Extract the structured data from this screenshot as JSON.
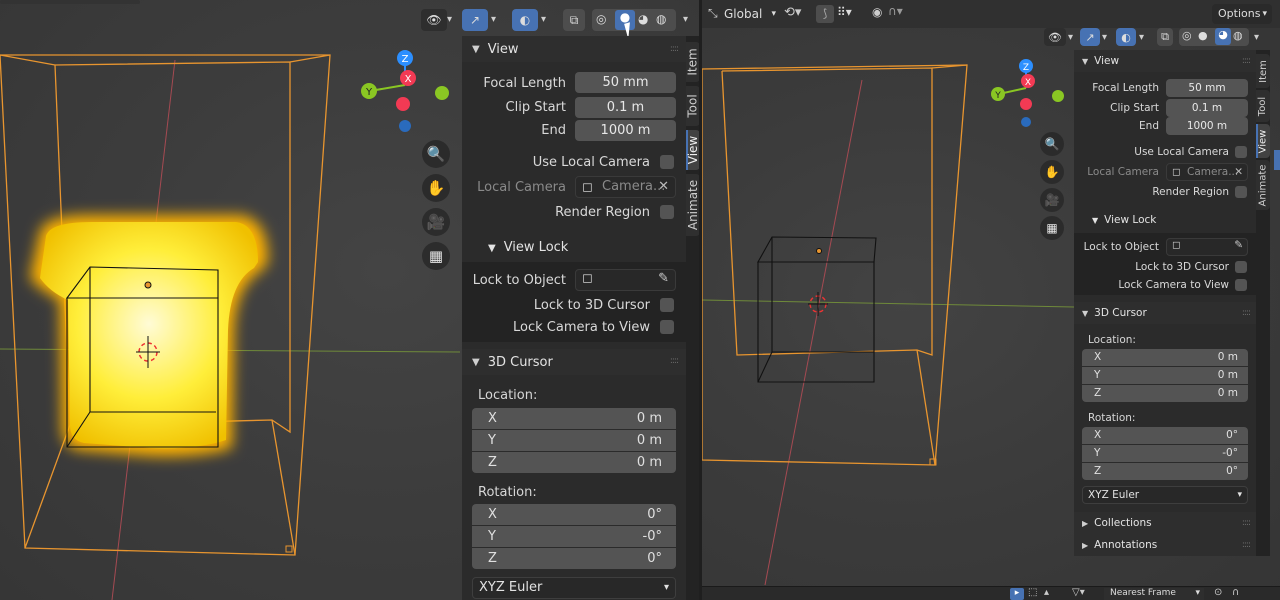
{
  "left": {
    "panel": {
      "view_title": "View",
      "focal_length_label": "Focal Length",
      "focal_length_value": "50 mm",
      "clip_start_label": "Clip Start",
      "clip_start_value": "0.1 m",
      "end_label": "End",
      "end_value": "1000 m",
      "use_local_camera_label": "Use Local Camera",
      "local_camera_label": "Local Camera",
      "local_camera_value": "Camera...",
      "render_region_label": "Render Region",
      "view_lock_title": "View Lock",
      "lock_to_object_label": "Lock to Object",
      "lock_3d_cursor_label": "Lock to 3D Cursor",
      "lock_camera_label": "Lock Camera to View",
      "cursor_title": "3D Cursor",
      "location_label": "Location:",
      "loc": [
        {
          "axis": "X",
          "value": "0 m"
        },
        {
          "axis": "Y",
          "value": "0 m"
        },
        {
          "axis": "Z",
          "value": "0 m"
        }
      ],
      "rotation_label": "Rotation:",
      "rot": [
        {
          "axis": "X",
          "value": "0°"
        },
        {
          "axis": "Y",
          "value": "-0°"
        },
        {
          "axis": "Z",
          "value": "0°"
        }
      ],
      "euler": "XYZ Euler"
    },
    "tabs": [
      "Item",
      "Tool",
      "View",
      "Animate"
    ],
    "gizmo": {
      "x": "X",
      "y": "Y",
      "z": "Z"
    }
  },
  "right": {
    "header": {
      "orientation": "Global",
      "options": "Options"
    },
    "panel": {
      "view_title": "View",
      "focal_length_label": "Focal Length",
      "focal_length_value": "50 mm",
      "clip_start_label": "Clip Start",
      "clip_start_value": "0.1 m",
      "end_label": "End",
      "end_value": "1000 m",
      "use_local_camera_label": "Use Local Camera",
      "local_camera_label": "Local Camera",
      "local_camera_value": "Camera...",
      "render_region_label": "Render Region",
      "view_lock_title": "View Lock",
      "lock_to_object_label": "Lock to Object",
      "lock_3d_cursor_label": "Lock to 3D Cursor",
      "lock_camera_label": "Lock Camera to View",
      "cursor_title": "3D Cursor",
      "location_label": "Location:",
      "loc": [
        {
          "axis": "X",
          "value": "0 m"
        },
        {
          "axis": "Y",
          "value": "0 m"
        },
        {
          "axis": "Z",
          "value": "0 m"
        }
      ],
      "rotation_label": "Rotation:",
      "rot": [
        {
          "axis": "X",
          "value": "0°"
        },
        {
          "axis": "Y",
          "value": "-0°"
        },
        {
          "axis": "Z",
          "value": "0°"
        }
      ],
      "euler": "XYZ Euler",
      "collections": "Collections",
      "annotations": "Annotations"
    },
    "tabs": [
      "Item",
      "Tool",
      "View",
      "Animate"
    ],
    "gizmo": {
      "x": "X",
      "y": "Y",
      "z": "Z"
    },
    "footer": {
      "keyframe": "Nearest Frame"
    }
  },
  "colors": {
    "accent": "#4772b3",
    "selection": "#e8952f",
    "axis_x": "#f33a54",
    "axis_y": "#8ac723",
    "axis_z": "#2c8fff"
  }
}
